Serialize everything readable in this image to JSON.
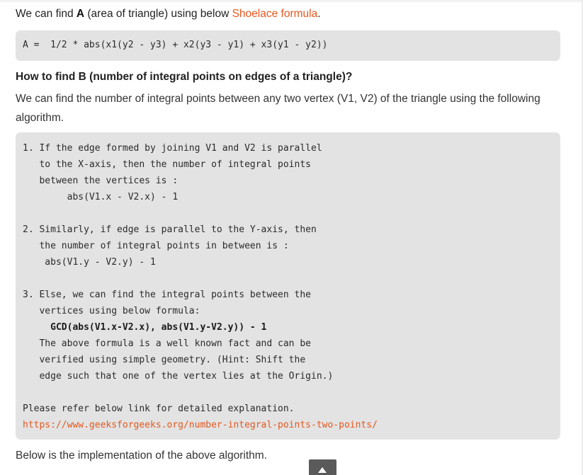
{
  "intro": {
    "pre": "We can find ",
    "bold": "A",
    "mid": " (area of triangle) using below ",
    "link": "Shoelace formula",
    "post": "."
  },
  "formula": "A =  1/2 * abs(x1(y2 - y3) + x2(y3 - y1) + x3(y1 - y2))",
  "heading": "How to find B (number of integral points on edges of a triangle)?",
  "paragraph": "We can find the number of integral points between any two vertex (V1, V2) of the triangle using the following algorithm.",
  "algorithm": {
    "step1": "1. If the edge formed by joining V1 and V2 is parallel\n   to the X-axis, then the number of integral points\n   between the vertices is :\n        abs(V1.x - V2.x) - 1",
    "step2": "2. Similarly, if edge is parallel to the Y-axis, then\n   the number of integral points in between is :\n    abs(V1.y - V2.y) - 1",
    "step3_intro": "3. Else, we can find the integral points between the\n   vertices using below formula:",
    "step3_formula": "GCD(abs(V1.x-V2.x), abs(V1.y-V2.y)) - 1",
    "step3_indent": "     ",
    "step3_rest": "   The above formula is a well known fact and can be\n   verified using simple geometry. (Hint: Shift the\n   edge such that one of the vertex lies at the Origin.)",
    "refer": "Please refer below link for detailed explanation.",
    "link": "https://www.geeksforgeeks.org/number-integral-points-two-points/"
  },
  "footer": "Below is the implementation of the above algorithm.",
  "icons": {
    "to_top": "arrow-up-icon"
  },
  "colors": {
    "link": "#e4571f",
    "code_bg": "#e3e3e3",
    "to_top_bg": "#5a5a5a"
  }
}
